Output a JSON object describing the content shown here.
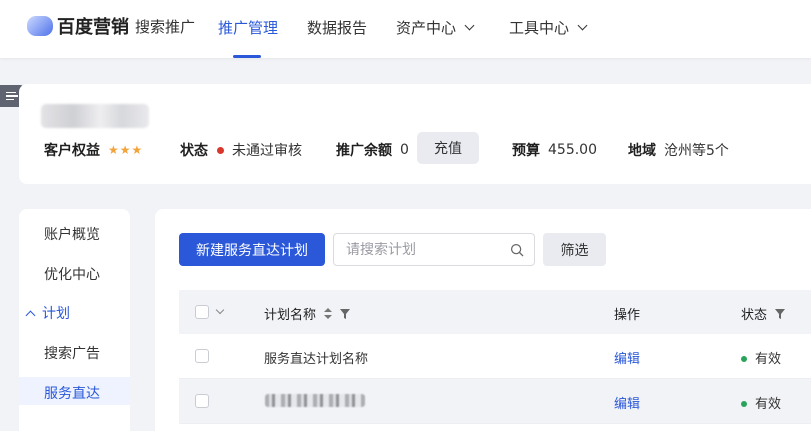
{
  "brand": {
    "logo_text": "百度营销",
    "product": "搜索推广"
  },
  "nav": {
    "items": [
      {
        "label": "推广管理",
        "active": true
      },
      {
        "label": "数据报告",
        "active": false
      },
      {
        "label": "资产中心",
        "active": false,
        "dropdown": true
      },
      {
        "label": "工具中心",
        "active": false,
        "dropdown": true
      }
    ]
  },
  "account": {
    "rights_label": "客户权益",
    "rights_stars": "★★★",
    "status_label": "状态",
    "status_value": "未通过审核",
    "balance_label": "推广余额",
    "balance_value": "0",
    "recharge_label": "充值",
    "budget_label": "预算",
    "budget_value": "455.00",
    "region_label": "地域",
    "region_value": "沧州等5个"
  },
  "sidebar": {
    "items": [
      {
        "label": "账户概览"
      },
      {
        "label": "优化中心"
      },
      {
        "label": "计划",
        "expanded": true
      },
      {
        "label": "搜索广告"
      },
      {
        "label": "服务直达",
        "active": true
      }
    ]
  },
  "toolbar": {
    "new_button": "新建服务直达计划",
    "search_placeholder": "请搜索计划",
    "filter_button": "筛选"
  },
  "table": {
    "columns": [
      "计划名称",
      "操作",
      "状态"
    ],
    "rows": [
      {
        "name": "服务直达计划名称",
        "action": "编辑",
        "status": "有效"
      },
      {
        "name": "",
        "action": "编辑",
        "status": "有效"
      }
    ]
  },
  "colors": {
    "accent": "#2b58d9",
    "status_error": "#d9362c",
    "status_ok": "#29a35a",
    "stars": "#f2a33a"
  }
}
